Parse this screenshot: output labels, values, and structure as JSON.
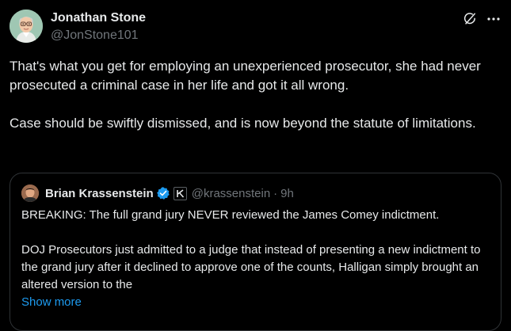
{
  "author": {
    "name": "Jonathan Stone",
    "handle": "@JonStone101",
    "avatar_icon": "cartoon-avatar-icon"
  },
  "actions": {
    "grok_icon": "grok-icon",
    "more_icon": "more-horizontal-icon"
  },
  "tweet": {
    "paragraphs": [
      "That's what you get for employing an unexperienced prosecutor, she had never prosecuted a criminal case in her life and got it all wrong.",
      "Case should be swiftly dismissed, and is now beyond the statute of limitations."
    ]
  },
  "quoted": {
    "name": "Brian Krassenstein",
    "verified_icon": "verified-badge-icon",
    "affiliation_icon": "k-affiliate-icon",
    "handle": "@krassenstein",
    "separator": "·",
    "time": "9h",
    "paragraphs": [
      "BREAKING: The full grand jury NEVER reviewed the James Comey indictment.",
      "DOJ Prosecutors just admitted to a judge that instead of presenting a new indictment to the grand jury after it declined to approve one of the counts, Halligan simply brought an altered version to the"
    ],
    "show_more": "Show more"
  },
  "colors": {
    "background": "#000000",
    "text": "#e7e9ea",
    "muted": "#71767b",
    "link": "#1d9bf0",
    "border": "#2f3336",
    "verified": "#1d9bf0"
  }
}
